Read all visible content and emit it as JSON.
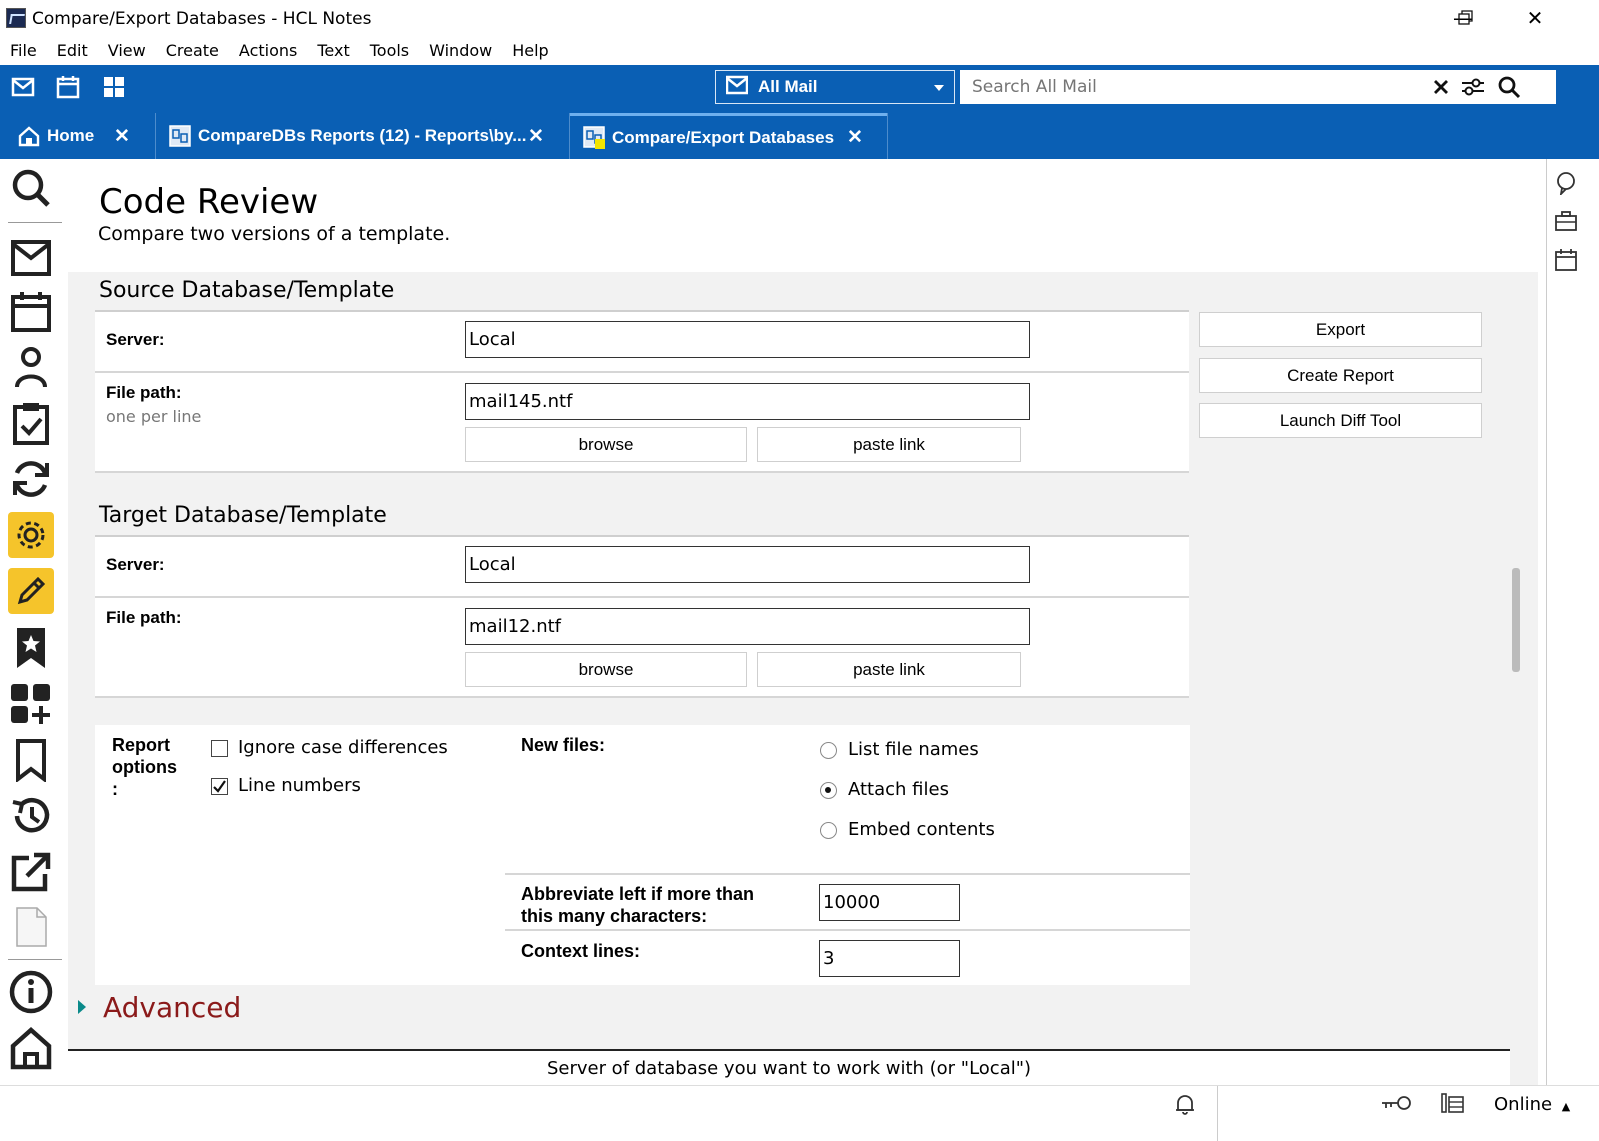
{
  "window": {
    "title": "Compare/Export Databases - HCL Notes",
    "minimize": "—",
    "restore": "❐",
    "close": "✕"
  },
  "menu": [
    "File",
    "Edit",
    "View",
    "Create",
    "Actions",
    "Text",
    "Tools",
    "Window",
    "Help"
  ],
  "toolbar": {
    "mail_scope": "All Mail",
    "search_placeholder": "Search All Mail"
  },
  "tabs": [
    {
      "label": "Home",
      "icon": "home-icon"
    },
    {
      "label": "CompareDBs Reports (12) - Reports\\by...",
      "icon": "database-icon"
    },
    {
      "label": "Compare/Export Databases",
      "icon": "database-icon",
      "active": true
    }
  ],
  "page": {
    "title": "Code Review",
    "subtitle": "Compare two versions of a template."
  },
  "source": {
    "heading": "Source Database/Template",
    "server_label": "Server:",
    "server_value": "Local",
    "filepath_label": "File path:",
    "filepath_hint": "one per line",
    "filepath_value": "mail145.ntf",
    "browse": "browse",
    "paste_link": "paste link"
  },
  "target": {
    "heading": "Target Database/Template",
    "server_label": "Server:",
    "server_value": "Local",
    "filepath_label": "File path:",
    "filepath_value": "mail12.ntf",
    "browse": "browse",
    "paste_link": "paste link"
  },
  "actions": {
    "export": "Export",
    "create_report": "Create Report",
    "launch_diff": "Launch Diff Tool"
  },
  "report_options": {
    "label_line1": "Report",
    "label_line2": "options",
    "label_line3": ":",
    "ignore_case": "Ignore case differences",
    "ignore_case_checked": false,
    "line_numbers": "Line numbers",
    "line_numbers_checked": true,
    "new_files_label": "New files:",
    "new_files_options": [
      "List file names",
      "Attach files",
      "Embed contents"
    ],
    "new_files_selected": "Attach files",
    "abbreviate_label_line1": "Abbreviate left if more than",
    "abbreviate_label_line2": "this many characters:",
    "abbreviate_value": "10000",
    "context_label": "Context lines:",
    "context_value": "3"
  },
  "advanced": "Advanced",
  "status_hint": "Server of database you want to work with (or \"Local\")",
  "statusbar": {
    "online": "Online"
  },
  "colors": {
    "toolbar_blue": "#0a5fb4",
    "highlight_yellow": "#f5c42b",
    "advanced_red": "#8b1a1a",
    "advanced_arrow": "#0a8a8a"
  }
}
